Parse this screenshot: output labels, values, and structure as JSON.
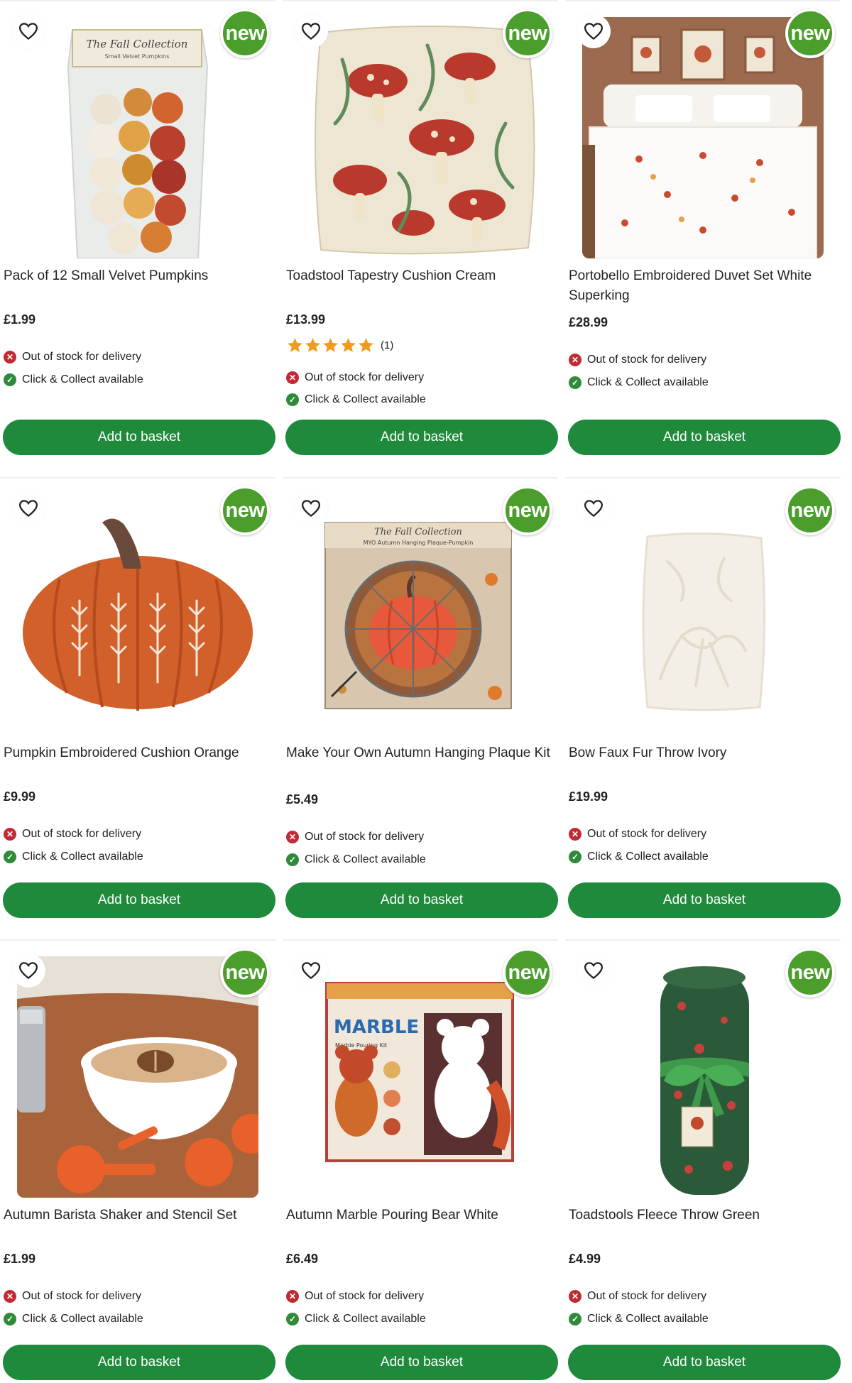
{
  "products": [
    {
      "title": "Pack of 12 Small Velvet Pumpkins",
      "price": "£1.99",
      "badge": "new",
      "image_label": "The Fall Collection",
      "image_sublabel": "Small Velvet Pumpkins",
      "delivery": "Out of stock for delivery",
      "collect": "Click & Collect available",
      "button": "Add to basket"
    },
    {
      "title": "Toadstool Tapestry Cushion Cream",
      "price": "£13.99",
      "badge": "new",
      "rating": 5,
      "rating_count": "(1)",
      "delivery": "Out of stock for delivery",
      "collect": "Click & Collect available",
      "button": "Add to basket"
    },
    {
      "title": "Portobello Embroidered Duvet Set White Superking",
      "price": "£28.99",
      "badge": "new",
      "delivery": "Out of stock for delivery",
      "collect": "Click & Collect available",
      "button": "Add to basket"
    },
    {
      "title": "Pumpkin Embroidered Cushion Orange",
      "price": "£9.99",
      "badge": "new",
      "delivery": "Out of stock for delivery",
      "collect": "Click & Collect available",
      "button": "Add to basket"
    },
    {
      "title": "Make Your Own Autumn Hanging Plaque Kit",
      "price": "£5.49",
      "badge": "new",
      "image_label": "The Fall Collection",
      "image_sublabel": "MYO Autumn Hanging Plaque-Pumpkin",
      "delivery": "Out of stock for delivery",
      "collect": "Click & Collect available",
      "button": "Add to basket"
    },
    {
      "title": "Bow Faux Fur Throw Ivory",
      "price": "£19.99",
      "badge": "new",
      "delivery": "Out of stock for delivery",
      "collect": "Click & Collect available",
      "button": "Add to basket"
    },
    {
      "title": "Autumn Barista Shaker and Stencil Set",
      "price": "£1.99",
      "badge": "new",
      "delivery": "Out of stock for delivery",
      "collect": "Click & Collect available",
      "button": "Add to basket"
    },
    {
      "title": "Autumn Marble Pouring Bear White",
      "price": "£6.49",
      "badge": "new",
      "image_label": "MARBLE BEAR",
      "image_sublabel": "Marble Pouring Kit",
      "delivery": "Out of stock for delivery",
      "collect": "Click & Collect available",
      "button": "Add to basket"
    },
    {
      "title": "Toadstools Fleece Throw Green",
      "price": "£4.99",
      "badge": "new",
      "delivery": "Out of stock for delivery",
      "collect": "Click & Collect available",
      "button": "Add to basket"
    }
  ],
  "colors": {
    "button_green": "#1f8a3b",
    "badge_green": "#4b9e2c",
    "error_red": "#c12a32",
    "success_green": "#2f8a3a",
    "star_orange": "#f29a1a"
  },
  "icons": {
    "wishlist": "heart-outline-icon",
    "out_of_stock": "cross-circle-icon",
    "available": "check-circle-icon",
    "rating": "star-icon"
  }
}
